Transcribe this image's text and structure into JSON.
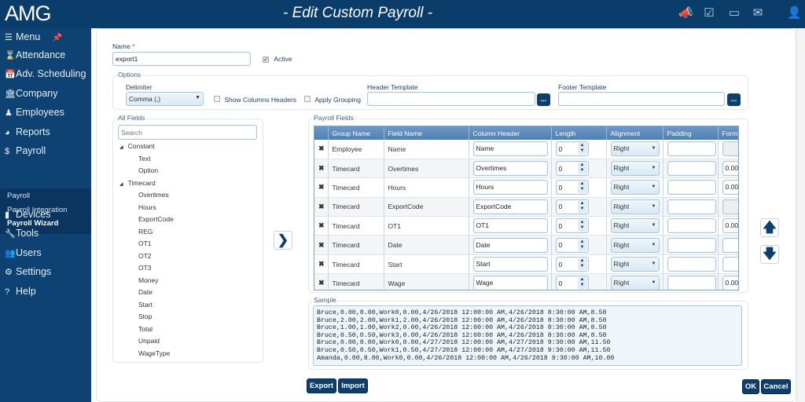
{
  "header": {
    "logo": "AMG",
    "title": "- Edit Custom Payroll -",
    "icons": [
      "megaphone-icon",
      "calendar-check-icon",
      "calendar-icon",
      "mail-icon",
      "user-icon"
    ]
  },
  "sidebar": {
    "menu": "Menu",
    "items": [
      {
        "label": "Attendance",
        "icon": "⌛"
      },
      {
        "label": "Adv. Scheduling",
        "icon": "📅"
      },
      {
        "label": "Company",
        "icon": "🏛"
      },
      {
        "label": "Employees",
        "icon": "♟"
      },
      {
        "label": "Reports",
        "icon": "◕"
      },
      {
        "label": "Payroll",
        "icon": "$"
      }
    ],
    "sub": [
      "Payroll",
      "Payroll Integration",
      "Payroll Wizard"
    ],
    "items2": [
      {
        "label": "Devices",
        "icon": "▮"
      },
      {
        "label": "Tools",
        "icon": "🔧"
      },
      {
        "label": "Users",
        "icon": "👥"
      },
      {
        "label": "Settings",
        "icon": "⚙"
      },
      {
        "label": "Help",
        "icon": "?"
      }
    ]
  },
  "form": {
    "name_label": "Name",
    "required": "*",
    "name_value": "export1",
    "active_label": "Active",
    "options_legend": "Options",
    "delimiter_label": "Delimiter",
    "delimiter_value": "Comma (,)",
    "show_headers": "Show Columns Headers",
    "apply_grouping": "Apply Grouping",
    "header_template": "Header Template",
    "footer_template": "Footer Template",
    "dots": "..."
  },
  "all_fields": {
    "legend": "All Fields",
    "search_placeholder": "Search",
    "tree": [
      {
        "label": "Constant",
        "group": true
      },
      {
        "label": "Text"
      },
      {
        "label": "Option"
      },
      {
        "label": "Timecard",
        "group": true
      },
      {
        "label": "Overtimes"
      },
      {
        "label": "Hours"
      },
      {
        "label": "ExportCode"
      },
      {
        "label": "REG"
      },
      {
        "label": "OT1"
      },
      {
        "label": "OT2"
      },
      {
        "label": "OT3"
      },
      {
        "label": "Money"
      },
      {
        "label": "Date"
      },
      {
        "label": "Start"
      },
      {
        "label": "Stop"
      },
      {
        "label": "Total"
      },
      {
        "label": "Unpaid"
      },
      {
        "label": "WageType"
      }
    ]
  },
  "payroll_fields": {
    "legend": "Payroll Fields",
    "columns": [
      "",
      "Group Name",
      "Field Name",
      "Column Header",
      "Length",
      "Alignment",
      "Padding",
      "Format"
    ],
    "rows": [
      {
        "group": "Employee",
        "field": "Name",
        "header": "Name",
        "length": "0",
        "align": "Right",
        "padding": "",
        "format": "",
        "format_disabled": true
      },
      {
        "group": "Timecard",
        "field": "Overtimes",
        "header": "Overtimes",
        "length": "0",
        "align": "Right",
        "padding": "",
        "format": "0.00"
      },
      {
        "group": "Timecard",
        "field": "Hours",
        "header": "Hours",
        "length": "0",
        "align": "Right",
        "padding": "",
        "format": "0.00"
      },
      {
        "group": "Timecard",
        "field": "ExportCode",
        "header": "ExportCode",
        "length": "0",
        "align": "Right",
        "padding": "",
        "format": "",
        "format_disabled": true
      },
      {
        "group": "Timecard",
        "field": "OT1",
        "header": "OT1",
        "length": "0",
        "align": "Right",
        "padding": "",
        "format": "0.00"
      },
      {
        "group": "Timecard",
        "field": "Date",
        "header": "Date",
        "length": "0",
        "align": "Right",
        "padding": "",
        "format": ""
      },
      {
        "group": "Timecard",
        "field": "Start",
        "header": "Start",
        "length": "0",
        "align": "Right",
        "padding": "",
        "format": ""
      },
      {
        "group": "Timecard",
        "field": "Wage",
        "header": "Wage",
        "length": "0",
        "align": "Right",
        "padding": "",
        "format": "0.00"
      }
    ]
  },
  "sample": {
    "legend": "Sample",
    "text": "Bruce,0.00,8.00,Work0,0.00,4/26/2018 12:00:00 AM,4/26/2018 8:30:00 AM,8.50\nBruce,2.00,2.00,Work1,2.00,4/26/2018 12:00:00 AM,4/26/2018 8:30:00 AM,8.50\nBruce,1.00,1.00,Work2,0.00,4/26/2018 12:00:00 AM,4/26/2018 8:30:00 AM,8.50\nBruce,0.50,0.50,Work3,0.00,4/26/2018 12:00:00 AM,4/26/2018 8:30:00 AM,8.50\nBruce,0.00,8.00,Work0,0.00,4/27/2018 12:00:00 AM,4/27/2018 9:30:00 AM,11.50\nBruce,0.50,0.50,Work1,0.50,4/27/2018 12:00:00 AM,4/27/2018 9:30:00 AM,11.50\nAmanda,0.00,8.00,Work0,0.00,4/26/2018 12:00:00 AM,4/26/2018 9:30:00 AM,10.00"
  },
  "buttons": {
    "export": "Export",
    "import": "Import",
    "ok": "OK",
    "cancel": "Cancel"
  },
  "colors": {
    "header": "#0b3d6b",
    "sidebar": "#0d4273",
    "button": "#0d3f6e",
    "table_header": "#5a88bb"
  }
}
